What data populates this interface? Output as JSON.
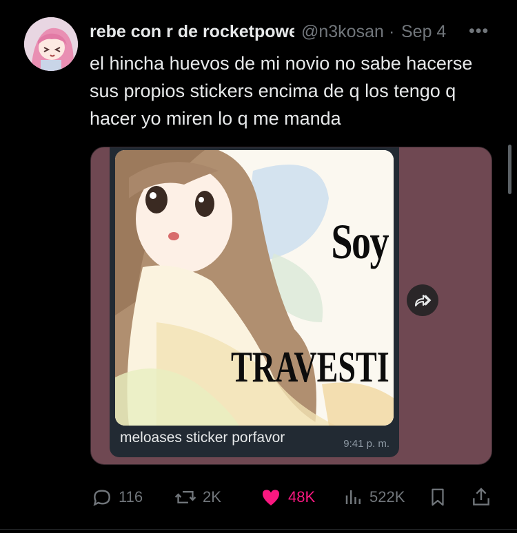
{
  "tweet": {
    "author_name": "rebe con r de rocketpower",
    "author_handle": "@n3kosan",
    "separator": "·",
    "date": "Sep 4",
    "more_label": "•••",
    "text": "el hincha huevos de mi novio no sabe hacerse sus propios stickers encima de q los tengo q hacer yo miren lo q me manda"
  },
  "media": {
    "sticker_text_top": "Soy",
    "sticker_text_bottom": "TRAVESTI",
    "message_caption": "meloases sticker porfavor",
    "message_time": "9:41 p. m.",
    "background_color": "#6f4852"
  },
  "actions": {
    "replies": "116",
    "reposts": "2K",
    "likes": "48K",
    "views": "522K",
    "like_color": "#f91880"
  }
}
